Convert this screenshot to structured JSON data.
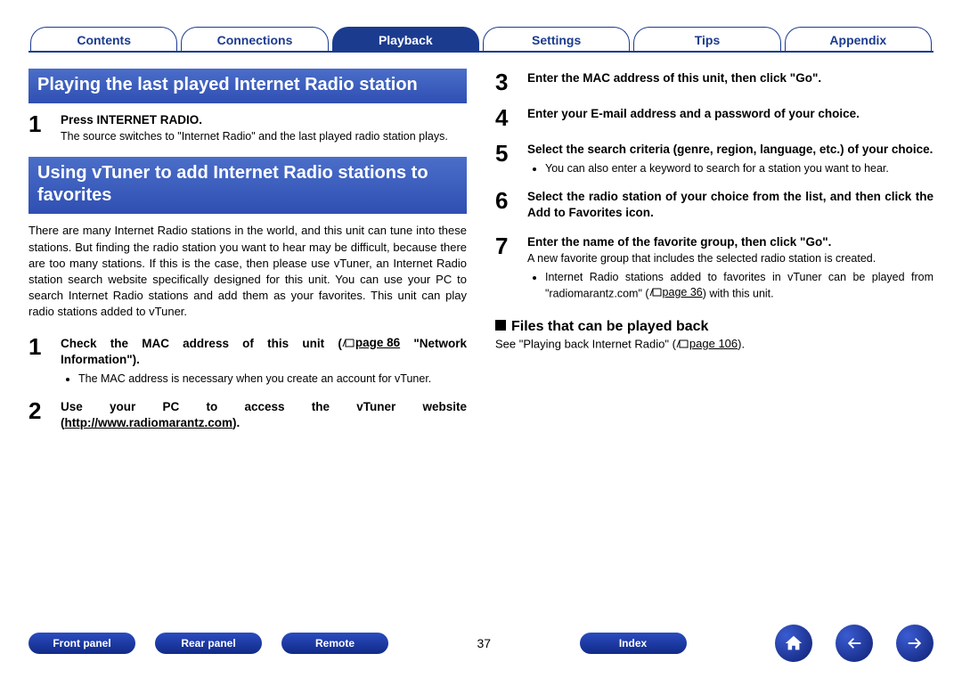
{
  "tabs": [
    "Contents",
    "Connections",
    "Playback",
    "Settings",
    "Tips",
    "Appendix"
  ],
  "activeTab": 2,
  "left": {
    "h1": "Playing the last played Internet Radio station",
    "s1": {
      "title": "Press INTERNET RADIO.",
      "body": "The source switches to \"Internet Radio\" and the last played radio station plays."
    },
    "h2": "Using vTuner to add Internet Radio stations to favorites",
    "para": "There are many Internet Radio stations in the world, and this unit can tune into these stations. But finding the radio station you want to hear may be difficult, because there are too many stations. If this is the case, then please use vTuner, an Internet Radio station search website specifically designed for this unit. You can use your PC to search Internet Radio stations and add them as your favorites. This unit can play radio stations added to vTuner.",
    "s2": {
      "title_a": "Check the MAC address of this unit (",
      "title_pg": "page 86",
      "title_b": " \"Network Information\").",
      "bul": "The MAC address is necessary when you create an account for vTuner."
    },
    "s3": {
      "title_a": "Use your PC to access the vTuner website (",
      "link": "http://www.radiomarantz.com",
      "title_b": ")."
    }
  },
  "right": {
    "s3": "Enter the MAC address of this unit, then click \"Go\".",
    "s4": "Enter your E-mail address and a password of your choice.",
    "s5": {
      "title": "Select the search criteria (genre, region, language, etc.) of your choice.",
      "bul": "You can also enter a keyword to search for a station you want to hear."
    },
    "s6": "Select the radio station of your choice from the list, and then click the Add to Favorites icon.",
    "s7": {
      "title": "Enter the name of the favorite group, then click \"Go\".",
      "body": "A new favorite group that includes the selected radio station is created.",
      "bul_a": "Internet Radio stations added to favorites in vTuner can be played from \"radiomarantz.com\" (",
      "bul_pg": "page 36",
      "bul_b": ") with this unit."
    },
    "files_h": "Files that can be played back",
    "files_a": "See \"Playing back Internet Radio\" (",
    "files_pg": "page 106",
    "files_b": ")."
  },
  "bottom": {
    "pills": [
      "Front panel",
      "Rear panel",
      "Remote"
    ],
    "page": "37",
    "index": "Index"
  }
}
